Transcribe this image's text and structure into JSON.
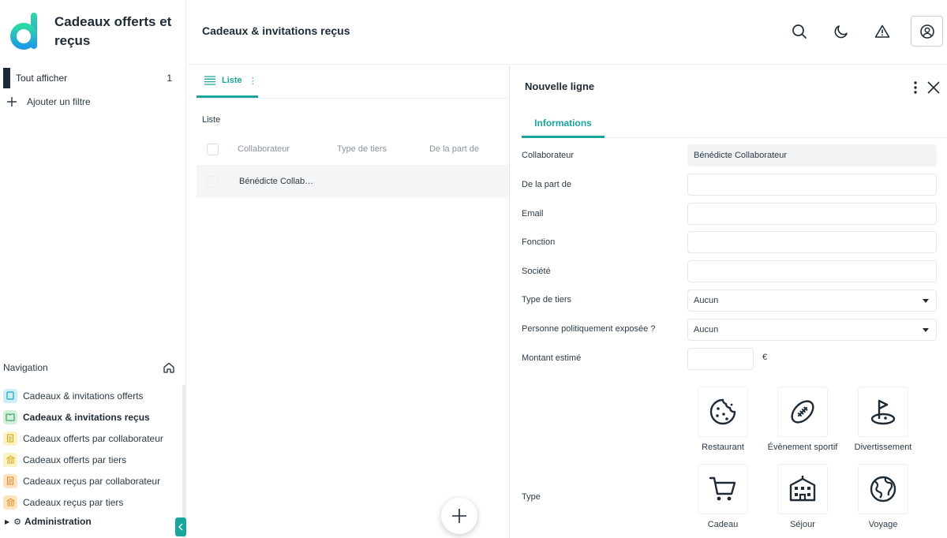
{
  "sidebar": {
    "app_title": "Cadeaux offerts et reçus",
    "filter": {
      "label": "Tout afficher",
      "count": "1"
    },
    "add_filter_label": "Ajouter un filtre",
    "navigation_label": "Navigation",
    "nav_items": [
      {
        "label": "Cadeaux & invitations offerts",
        "icon": "book-icon",
        "icon_bg": "#cdeef4",
        "icon_color": "#1ba3bf"
      },
      {
        "label": "Cadeaux & invitations reçus",
        "icon": "open-book-icon",
        "icon_bg": "#d4efd9",
        "icon_color": "#2e9a52",
        "active": true
      },
      {
        "label": "Cadeaux offerts par collaborateur",
        "icon": "document-icon",
        "icon_bg": "#fbf2c5",
        "icon_color": "#d1a81a"
      },
      {
        "label": "Cadeaux offerts par tiers",
        "icon": "bank-icon",
        "icon_bg": "#fbf2c5",
        "icon_color": "#d1a81a"
      },
      {
        "label": "Cadeaux reçus par collaborateur",
        "icon": "document-icon",
        "icon_bg": "#fde3c0",
        "icon_color": "#e0902a"
      },
      {
        "label": "Cadeaux reçus par tiers",
        "icon": "bank-icon",
        "icon_bg": "#fde3c0",
        "icon_color": "#e0902a"
      }
    ],
    "admin_label": "Administration"
  },
  "header": {
    "title": "Cadeaux & invitations reçus",
    "icons": [
      "search-icon",
      "moon-icon",
      "warning-icon",
      "user-icon"
    ]
  },
  "main": {
    "tab_label": "Liste",
    "list_heading": "Liste",
    "columns": [
      "Collaborateur",
      "Type de tiers",
      "De la part de"
    ],
    "rows": [
      {
        "collaborateur": "Bénédicte Collab…",
        "type_de_tiers": "",
        "de_la_part_de": ""
      }
    ]
  },
  "panel": {
    "title": "Nouvelle ligne",
    "tab_label": "Informations",
    "fields": {
      "collaborateur": {
        "label": "Collaborateur",
        "value": "Bénédicte Collaborateur"
      },
      "de_la_part_de": {
        "label": "De la part de",
        "value": ""
      },
      "email": {
        "label": "Email",
        "value": ""
      },
      "fonction": {
        "label": "Fonction",
        "value": ""
      },
      "societe": {
        "label": "Société",
        "value": ""
      },
      "type_de_tiers": {
        "label": "Type de tiers",
        "value": "Aucun"
      },
      "ppe": {
        "label": "Personne politiquement exposée ?",
        "value": "Aucun"
      },
      "montant": {
        "label": "Montant estimé",
        "value": "",
        "currency": "€"
      },
      "type": {
        "label": "Type"
      }
    },
    "type_options": [
      {
        "label": "Restaurant",
        "icon": "cookie-icon"
      },
      {
        "label": "Évènement sportif",
        "icon": "football-icon"
      },
      {
        "label": "Divertissement",
        "icon": "golf-icon"
      },
      {
        "label": "Cadeau",
        "icon": "cart-icon"
      },
      {
        "label": "Séjour",
        "icon": "hotel-icon"
      },
      {
        "label": "Voyage",
        "icon": "globe-icon"
      }
    ]
  },
  "colors": {
    "accent": "#1aa69c",
    "dark": "#1e2a35",
    "logo_gradient": [
      "#2ed8a6",
      "#1e9be6"
    ]
  }
}
